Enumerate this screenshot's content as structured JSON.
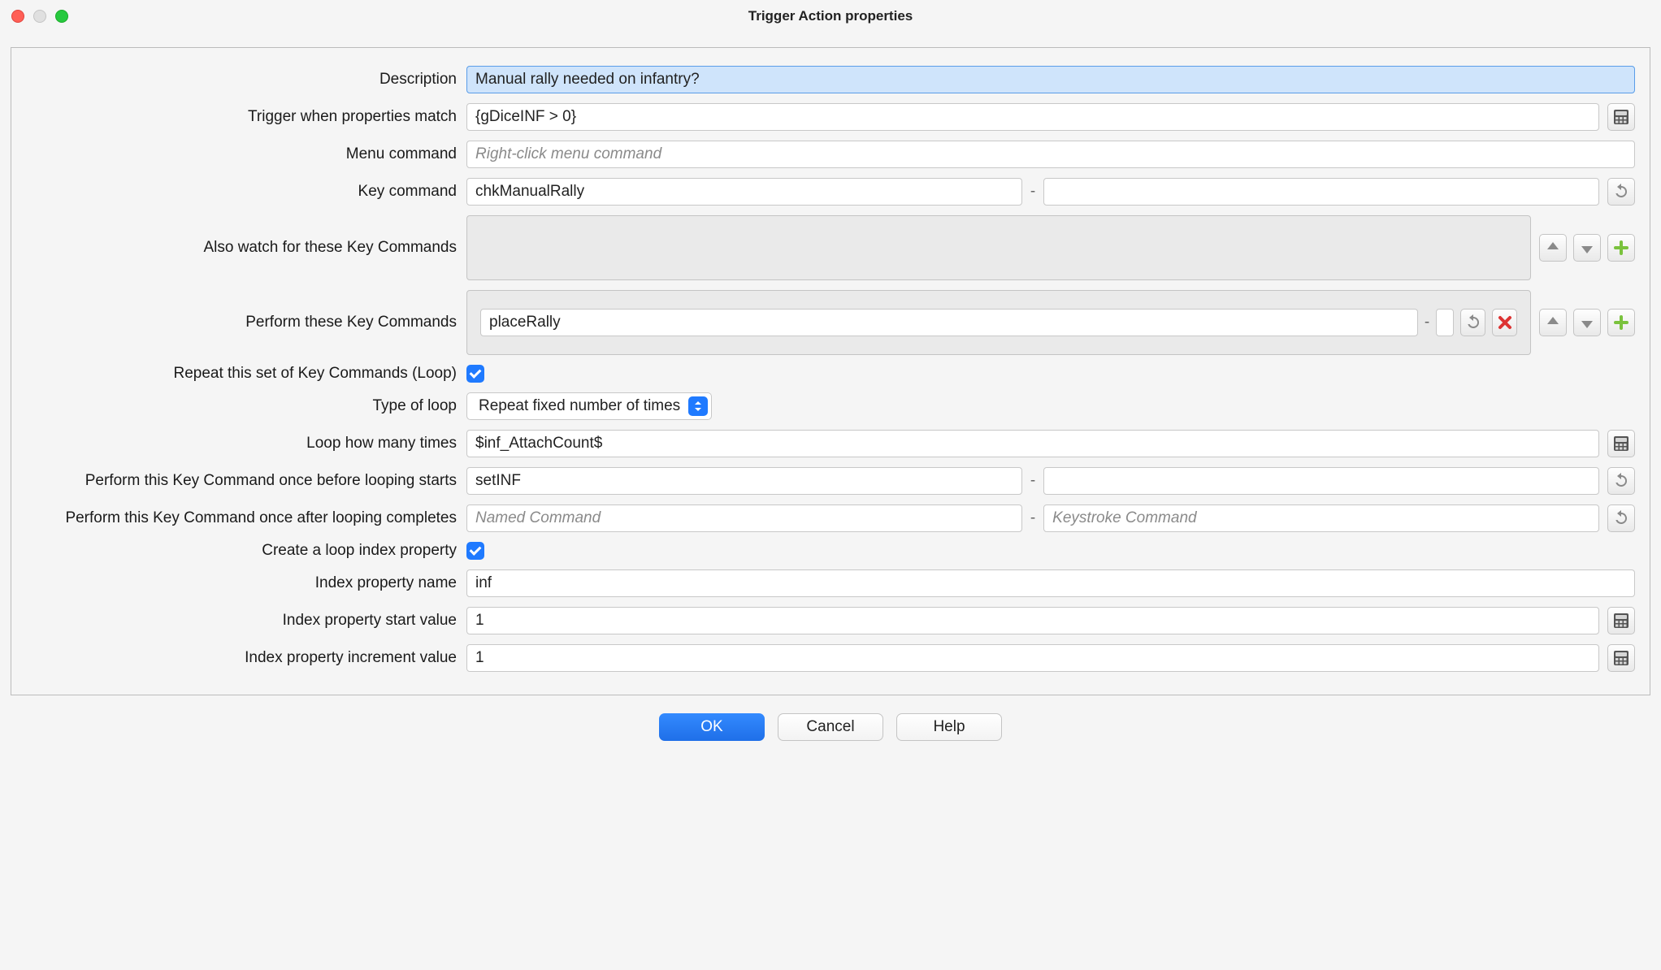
{
  "window": {
    "title": "Trigger Action properties"
  },
  "labels": {
    "description": "Description",
    "triggerMatch": "Trigger when properties match",
    "menuCommand": "Menu command",
    "keyCommand": "Key command",
    "alsoWatch": "Also watch for these Key Commands",
    "perform": "Perform these Key Commands",
    "repeatLoop": "Repeat this set of Key Commands (Loop)",
    "typeLoop": "Type of loop",
    "loopTimes": "Loop how many times",
    "beforeLoop": "Perform this Key Command once before looping starts",
    "afterLoop": "Perform this Key Command once after looping completes",
    "createIndex": "Create a loop index property",
    "indexName": "Index property name",
    "indexStart": "Index property start value",
    "indexInc": "Index property increment value"
  },
  "values": {
    "description": "Manual rally needed on infantry?",
    "triggerMatch": "{gDiceINF > 0}",
    "menuPlaceholder": "Right-click menu command",
    "keyCommand": "chkManualRally",
    "keyCommand2": "",
    "performName": "placeRally",
    "performKey": "",
    "typeLoop": "Repeat fixed number of times",
    "loopTimes": "$inf_AttachCount$",
    "beforeName": "setINF",
    "beforeKey": "",
    "afterNamePH": "Named Command",
    "afterKeyPH": "Keystroke Command",
    "indexName": "inf",
    "indexStart": "1",
    "indexInc": "1"
  },
  "buttons": {
    "ok": "OK",
    "cancel": "Cancel",
    "help": "Help"
  }
}
